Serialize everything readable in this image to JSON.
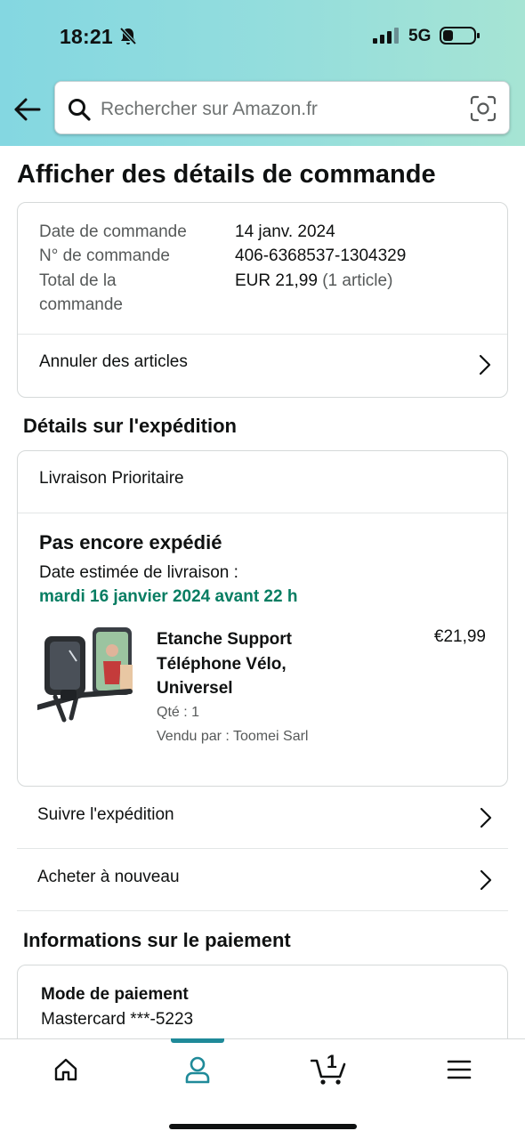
{
  "status_bar": {
    "time": "18:21",
    "network": "5G"
  },
  "search": {
    "placeholder": "Rechercher sur Amazon.fr"
  },
  "page": {
    "title": "Afficher des détails de commande"
  },
  "order": {
    "date_label": "Date de commande",
    "date_value": "14 janv. 2024",
    "number_label": "N° de commande",
    "number_value": "406-6368537-1304329",
    "total_label_1": "Total de la",
    "total_label_2": "commande",
    "total_value": "EUR 21,99",
    "total_items": "(1 article)",
    "cancel_label": "Annuler des articles"
  },
  "shipping": {
    "section_title": "Détails sur l'expédition",
    "method": "Livraison Prioritaire",
    "status": "Pas encore expédié",
    "estimate_label": "Date estimée de livraison :",
    "estimate_date": "mardi 16 janvier 2024 avant 22 h",
    "product": {
      "name": "Etanche Support Téléphone Vélo, Universel",
      "price": "€21,99",
      "qty": "Qté : 1",
      "seller": "Vendu par : Toomei Sarl"
    },
    "track_label": "Suivre l'expédition",
    "buy_again_label": "Acheter à nouveau"
  },
  "payment": {
    "section_title": "Informations sur le paiement",
    "method_label": "Mode de paiement",
    "method_value": "Mastercard ***-5223"
  },
  "bottom_nav": {
    "items": [
      "home-icon",
      "account-icon",
      "cart-icon",
      "menu-icon"
    ],
    "active": "account-icon",
    "cart_count": "1"
  },
  "colors": {
    "accent": "#1f8a99",
    "delivery_green": "#067d62",
    "header_gradient_start": "#84d7e1",
    "header_gradient_end": "#a6e4d4"
  }
}
